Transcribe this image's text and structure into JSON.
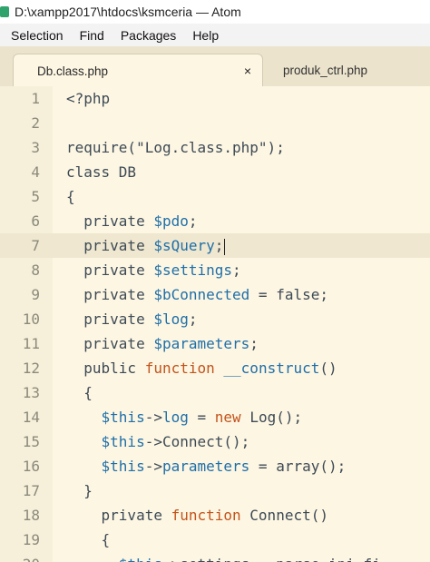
{
  "window": {
    "title": "D:\\xampp2017\\htdocs\\ksmceria — Atom"
  },
  "menu": [
    "Selection",
    "Find",
    "Packages",
    "Help"
  ],
  "tabs": [
    {
      "label": "Db.class.php",
      "active": true,
      "close": "×"
    },
    {
      "label": "produk_ctrl.php",
      "active": false
    }
  ],
  "editor": {
    "current_line": 7,
    "lines": [
      {
        "n": "1",
        "tokens": [
          [
            "def",
            "<?php"
          ]
        ]
      },
      {
        "n": "2",
        "tokens": []
      },
      {
        "n": "3",
        "tokens": [
          [
            "def",
            "require(\"Log.class.php\");"
          ]
        ]
      },
      {
        "n": "4",
        "tokens": [
          [
            "def",
            "class DB"
          ]
        ]
      },
      {
        "n": "5",
        "tokens": [
          [
            "def",
            "{"
          ]
        ]
      },
      {
        "n": "6",
        "tokens": [
          [
            "def",
            "  private "
          ],
          [
            "var",
            "$pdo"
          ],
          [
            "def",
            ";"
          ]
        ]
      },
      {
        "n": "7",
        "tokens": [
          [
            "def",
            "  private "
          ],
          [
            "var",
            "$sQuery"
          ],
          [
            "def",
            ";"
          ]
        ]
      },
      {
        "n": "8",
        "tokens": [
          [
            "def",
            "  private "
          ],
          [
            "var",
            "$settings"
          ],
          [
            "def",
            ";"
          ]
        ]
      },
      {
        "n": "9",
        "tokens": [
          [
            "def",
            "  private "
          ],
          [
            "var",
            "$bConnected"
          ],
          [
            "def",
            " = false;"
          ]
        ]
      },
      {
        "n": "10",
        "tokens": [
          [
            "def",
            "  private "
          ],
          [
            "var",
            "$log"
          ],
          [
            "def",
            ";"
          ]
        ]
      },
      {
        "n": "11",
        "tokens": [
          [
            "def",
            "  private "
          ],
          [
            "var",
            "$parameters"
          ],
          [
            "def",
            ";"
          ]
        ]
      },
      {
        "n": "12",
        "tokens": [
          [
            "def",
            "  public "
          ],
          [
            "fn",
            "function"
          ],
          [
            "def",
            " "
          ],
          [
            "var",
            "__construct"
          ],
          [
            "def",
            "()"
          ]
        ]
      },
      {
        "n": "13",
        "tokens": [
          [
            "def",
            "  {"
          ]
        ]
      },
      {
        "n": "14",
        "tokens": [
          [
            "def",
            "    "
          ],
          [
            "var",
            "$this"
          ],
          [
            "def",
            "->"
          ],
          [
            "var",
            "log"
          ],
          [
            "def",
            " = "
          ],
          [
            "fn",
            "new"
          ],
          [
            "def",
            " Log();"
          ]
        ]
      },
      {
        "n": "15",
        "tokens": [
          [
            "def",
            "    "
          ],
          [
            "var",
            "$this"
          ],
          [
            "def",
            "->Connect();"
          ]
        ]
      },
      {
        "n": "16",
        "tokens": [
          [
            "def",
            "    "
          ],
          [
            "var",
            "$this"
          ],
          [
            "def",
            "->"
          ],
          [
            "var",
            "parameters"
          ],
          [
            "def",
            " = array();"
          ]
        ]
      },
      {
        "n": "17",
        "tokens": [
          [
            "def",
            "  }"
          ]
        ]
      },
      {
        "n": "18",
        "tokens": [
          [
            "def",
            "    private "
          ],
          [
            "fn",
            "function"
          ],
          [
            "def",
            " Connect()"
          ]
        ]
      },
      {
        "n": "19",
        "tokens": [
          [
            "def",
            "    {"
          ]
        ]
      },
      {
        "n": "20",
        "tokens": [
          [
            "def",
            "      "
          ],
          [
            "var",
            "$this"
          ],
          [
            "def",
            "->settings = parse_ini_fi"
          ]
        ]
      }
    ]
  },
  "colors": {
    "background": "#fdf6e3",
    "keyword": "#576f00",
    "variable": "#1f6fa8",
    "function_kw": "#c2541c"
  }
}
